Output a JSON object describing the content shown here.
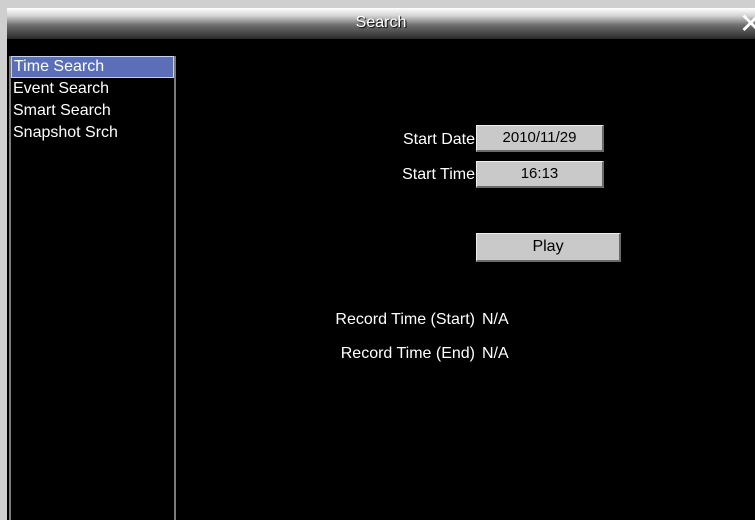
{
  "window": {
    "title": "Search",
    "close_glyph": "✕",
    "close_icon": "close-icon"
  },
  "sidebar": {
    "items": [
      {
        "label": "Time Search",
        "active": true
      },
      {
        "label": "Event Search",
        "active": false
      },
      {
        "label": "Smart Search",
        "active": false
      },
      {
        "label": "Snapshot Srch",
        "active": false
      }
    ]
  },
  "main": {
    "start_date_label": "Start Date",
    "start_date_value": "2010/11/29",
    "start_time_label": "Start Time",
    "start_time_value": "16:13",
    "play_label": "Play",
    "record_start_label": "Record Time (Start)",
    "record_start_value": "N/A",
    "record_end_label": "Record Time (End)",
    "record_end_value": "N/A"
  },
  "colors": {
    "active_item": "#5a6fb8",
    "field_bg": "#c9c9c9",
    "background": "#000000"
  }
}
